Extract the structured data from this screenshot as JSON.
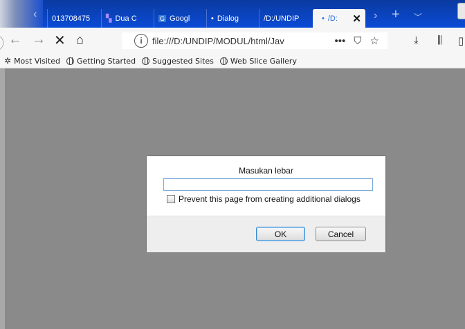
{
  "tabs": [
    {
      "label": "013708475",
      "icon": "page-icon"
    },
    {
      "label": "Dua C",
      "icon": "dua-icon"
    },
    {
      "label": "Googl",
      "icon": "google-icon"
    },
    {
      "label": "Dialog",
      "icon": "dot-icon"
    },
    {
      "label": "/D:/UNDIP",
      "icon": "none"
    },
    {
      "label": "/D:",
      "icon": "dot-icon",
      "active": true
    }
  ],
  "nav": {
    "url_main": "file:///D:/UNDIP/MODUL/html/Jav",
    "more": "•••"
  },
  "bookmarks": [
    {
      "label": "Most Visited",
      "icon": "gear-icon"
    },
    {
      "label": "Getting Started",
      "icon": "globe-icon"
    },
    {
      "label": "Suggested Sites",
      "icon": "globe-icon"
    },
    {
      "label": "Web Slice Gallery",
      "icon": "globe-icon"
    }
  ],
  "dialog": {
    "message": "Masukan lebar",
    "input_value": "",
    "checkbox_label": "Prevent this page from creating additional dialogs",
    "ok_label": "OK",
    "cancel_label": "Cancel"
  },
  "colors": {
    "tabstrip": "#0b4bd6",
    "active_tab_text": "#2a6fe0",
    "content_bg": "#8a8a8a"
  }
}
